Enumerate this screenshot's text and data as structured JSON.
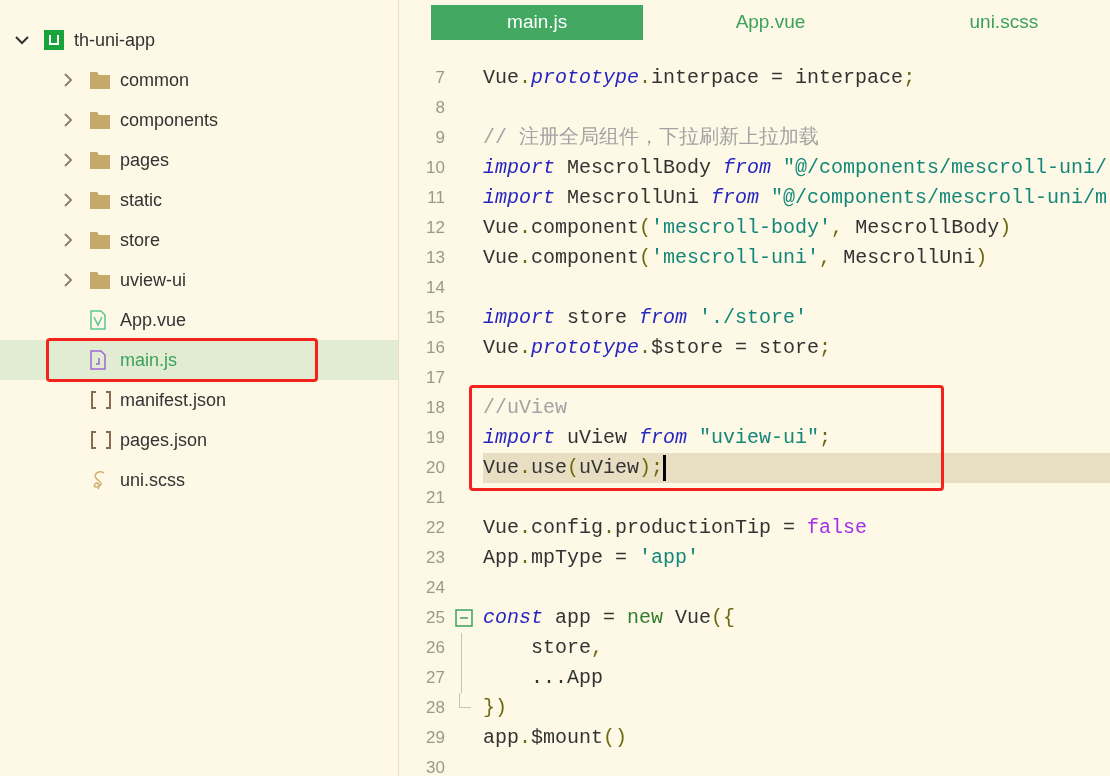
{
  "sidebar": {
    "tree": [
      {
        "label": "th-uni-app",
        "kind": "project",
        "expanded": true,
        "selected": false,
        "annotated": false,
        "children": [
          {
            "label": "common",
            "kind": "folder",
            "expanded": false,
            "selected": false,
            "annotated": false
          },
          {
            "label": "components",
            "kind": "folder",
            "expanded": false,
            "selected": false,
            "annotated": false
          },
          {
            "label": "pages",
            "kind": "folder",
            "expanded": false,
            "selected": false,
            "annotated": false
          },
          {
            "label": "static",
            "kind": "folder",
            "expanded": false,
            "selected": false,
            "annotated": false
          },
          {
            "label": "store",
            "kind": "folder",
            "expanded": false,
            "selected": false,
            "annotated": false
          },
          {
            "label": "uview-ui",
            "kind": "folder",
            "expanded": false,
            "selected": false,
            "annotated": false
          },
          {
            "label": "App.vue",
            "kind": "vue",
            "selected": false,
            "annotated": false
          },
          {
            "label": "main.js",
            "kind": "js",
            "selected": true,
            "annotated": true
          },
          {
            "label": "manifest.json",
            "kind": "json",
            "selected": false,
            "annotated": false
          },
          {
            "label": "pages.json",
            "kind": "json",
            "selected": false,
            "annotated": false
          },
          {
            "label": "uni.scss",
            "kind": "scss",
            "selected": false,
            "annotated": false
          }
        ]
      }
    ]
  },
  "tabs": [
    {
      "label": "main.js",
      "selected": true
    },
    {
      "label": "App.vue",
      "selected": false
    },
    {
      "label": "uni.scss",
      "selected": false
    }
  ],
  "editor": {
    "blocks": [
      {
        "annotated": false,
        "lines": [
          {
            "number": "7",
            "tokens": [
              {
                "kind": "plain",
                "text": "Vue"
              },
              {
                "kind": "punct",
                "text": "."
              },
              {
                "kind": "keyword",
                "text": "prototype"
              },
              {
                "kind": "punct",
                "text": "."
              },
              {
                "kind": "plain",
                "text": "interpace = interpace"
              },
              {
                "kind": "punct",
                "text": ";"
              }
            ]
          },
          {
            "number": "8"
          },
          {
            "number": "9",
            "tokens": [
              {
                "kind": "comment",
                "text": "// 注册全局组件，下拉刷新上拉加载"
              }
            ]
          },
          {
            "number": "10",
            "tokens": [
              {
                "kind": "keyword",
                "text": "import"
              },
              {
                "kind": "plain",
                "text": " MescrollBody "
              },
              {
                "kind": "keyword",
                "text": "from"
              },
              {
                "kind": "string",
                "text": " \"@/components/mescroll-uni/"
              }
            ]
          },
          {
            "number": "11",
            "tokens": [
              {
                "kind": "keyword",
                "text": "import"
              },
              {
                "kind": "plain",
                "text": " MescrollUni "
              },
              {
                "kind": "keyword",
                "text": "from"
              },
              {
                "kind": "string",
                "text": " \"@/components/mescroll-uni/m"
              }
            ]
          },
          {
            "number": "12",
            "tokens": [
              {
                "kind": "plain",
                "text": "Vue"
              },
              {
                "kind": "punct",
                "text": "."
              },
              {
                "kind": "plain",
                "text": "component"
              },
              {
                "kind": "punct",
                "text": "("
              },
              {
                "kind": "string",
                "text": "'mescroll-body'"
              },
              {
                "kind": "punct",
                "text": ","
              },
              {
                "kind": "plain",
                "text": " MescrollBody"
              },
              {
                "kind": "punct",
                "text": ")"
              }
            ]
          },
          {
            "number": "13",
            "tokens": [
              {
                "kind": "plain",
                "text": "Vue"
              },
              {
                "kind": "punct",
                "text": "."
              },
              {
                "kind": "plain",
                "text": "component"
              },
              {
                "kind": "punct",
                "text": "("
              },
              {
                "kind": "string",
                "text": "'mescroll-uni'"
              },
              {
                "kind": "punct",
                "text": ","
              },
              {
                "kind": "plain",
                "text": " MescrollUni"
              },
              {
                "kind": "punct",
                "text": ")"
              }
            ]
          },
          {
            "number": "14"
          },
          {
            "number": "15",
            "tokens": [
              {
                "kind": "keyword",
                "text": "import"
              },
              {
                "kind": "plain",
                "text": " store "
              },
              {
                "kind": "keyword",
                "text": "from"
              },
              {
                "kind": "string",
                "text": " './store'"
              }
            ]
          },
          {
            "number": "16",
            "tokens": [
              {
                "kind": "plain",
                "text": "Vue"
              },
              {
                "kind": "punct",
                "text": "."
              },
              {
                "kind": "keyword",
                "text": "prototype"
              },
              {
                "kind": "punct",
                "text": "."
              },
              {
                "kind": "plain",
                "text": "$store = store"
              },
              {
                "kind": "punct",
                "text": ";"
              }
            ]
          },
          {
            "number": "17"
          }
        ]
      },
      {
        "annotated": true,
        "lines": [
          {
            "number": "18",
            "tokens": [
              {
                "kind": "comment",
                "text": "//uView"
              }
            ]
          },
          {
            "number": "19",
            "tokens": [
              {
                "kind": "keyword",
                "text": "import"
              },
              {
                "kind": "plain",
                "text": " uView "
              },
              {
                "kind": "keyword",
                "text": "from"
              },
              {
                "kind": "string",
                "text": " \"uview-ui\""
              },
              {
                "kind": "punct",
                "text": ";"
              }
            ]
          },
          {
            "number": "20",
            "current": true,
            "tokens": [
              {
                "kind": "plain",
                "text": "Vue"
              },
              {
                "kind": "punct",
                "text": "."
              },
              {
                "kind": "plain",
                "text": "use"
              },
              {
                "kind": "punct",
                "text": "("
              },
              {
                "kind": "plain",
                "text": "uView"
              },
              {
                "kind": "punct",
                "text": ");"
              }
            ]
          }
        ]
      },
      {
        "annotated": false,
        "lines": [
          {
            "number": "21"
          },
          {
            "number": "22",
            "tokens": [
              {
                "kind": "plain",
                "text": "Vue"
              },
              {
                "kind": "punct",
                "text": "."
              },
              {
                "kind": "plain",
                "text": "config"
              },
              {
                "kind": "punct",
                "text": "."
              },
              {
                "kind": "plain",
                "text": "productionTip = "
              },
              {
                "kind": "literal",
                "text": "false"
              }
            ]
          },
          {
            "number": "23",
            "tokens": [
              {
                "kind": "plain",
                "text": "App"
              },
              {
                "kind": "punct",
                "text": "."
              },
              {
                "kind": "plain",
                "text": "mpType = "
              },
              {
                "kind": "string",
                "text": "'app'"
              }
            ]
          },
          {
            "number": "24"
          },
          {
            "number": "25",
            "collapsible": true,
            "tokens": [
              {
                "kind": "keyword",
                "text": "const"
              },
              {
                "kind": "plain",
                "text": " app = "
              },
              {
                "kind": "operator",
                "text": "new"
              },
              {
                "kind": "plain",
                "text": " Vue"
              },
              {
                "kind": "punct",
                "text": "({"
              }
            ]
          },
          {
            "number": "26",
            "in_fold": true,
            "tokens": [
              {
                "kind": "plain",
                "text": "    store"
              },
              {
                "kind": "punct",
                "text": ","
              }
            ]
          },
          {
            "number": "27",
            "in_fold": true,
            "tokens": [
              {
                "kind": "plain",
                "text": "    ...App"
              }
            ]
          },
          {
            "number": "28",
            "fold_end": true,
            "tokens": [
              {
                "kind": "punct",
                "text": "})"
              }
            ]
          },
          {
            "number": "29",
            "tokens": [
              {
                "kind": "plain",
                "text": "app"
              },
              {
                "kind": "punct",
                "text": "."
              },
              {
                "kind": "plain",
                "text": "$mount"
              },
              {
                "kind": "punct",
                "text": "()"
              }
            ]
          },
          {
            "number": "30"
          }
        ]
      }
    ]
  }
}
